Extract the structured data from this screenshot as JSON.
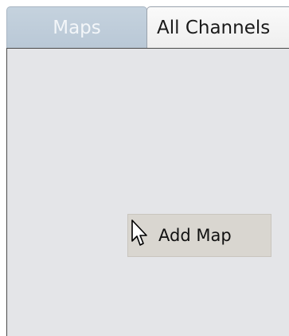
{
  "tabs": [
    {
      "label": "Maps",
      "active": true
    },
    {
      "label": "All Channels",
      "active": false
    }
  ],
  "panel": {
    "add_map_label": "Add Map"
  },
  "colors": {
    "active_tab": "#bccad8",
    "panel_background": "#e4e5e8",
    "button_background": "#d9d6d0"
  },
  "icons": {
    "cursor": "mouse-pointer-icon"
  }
}
